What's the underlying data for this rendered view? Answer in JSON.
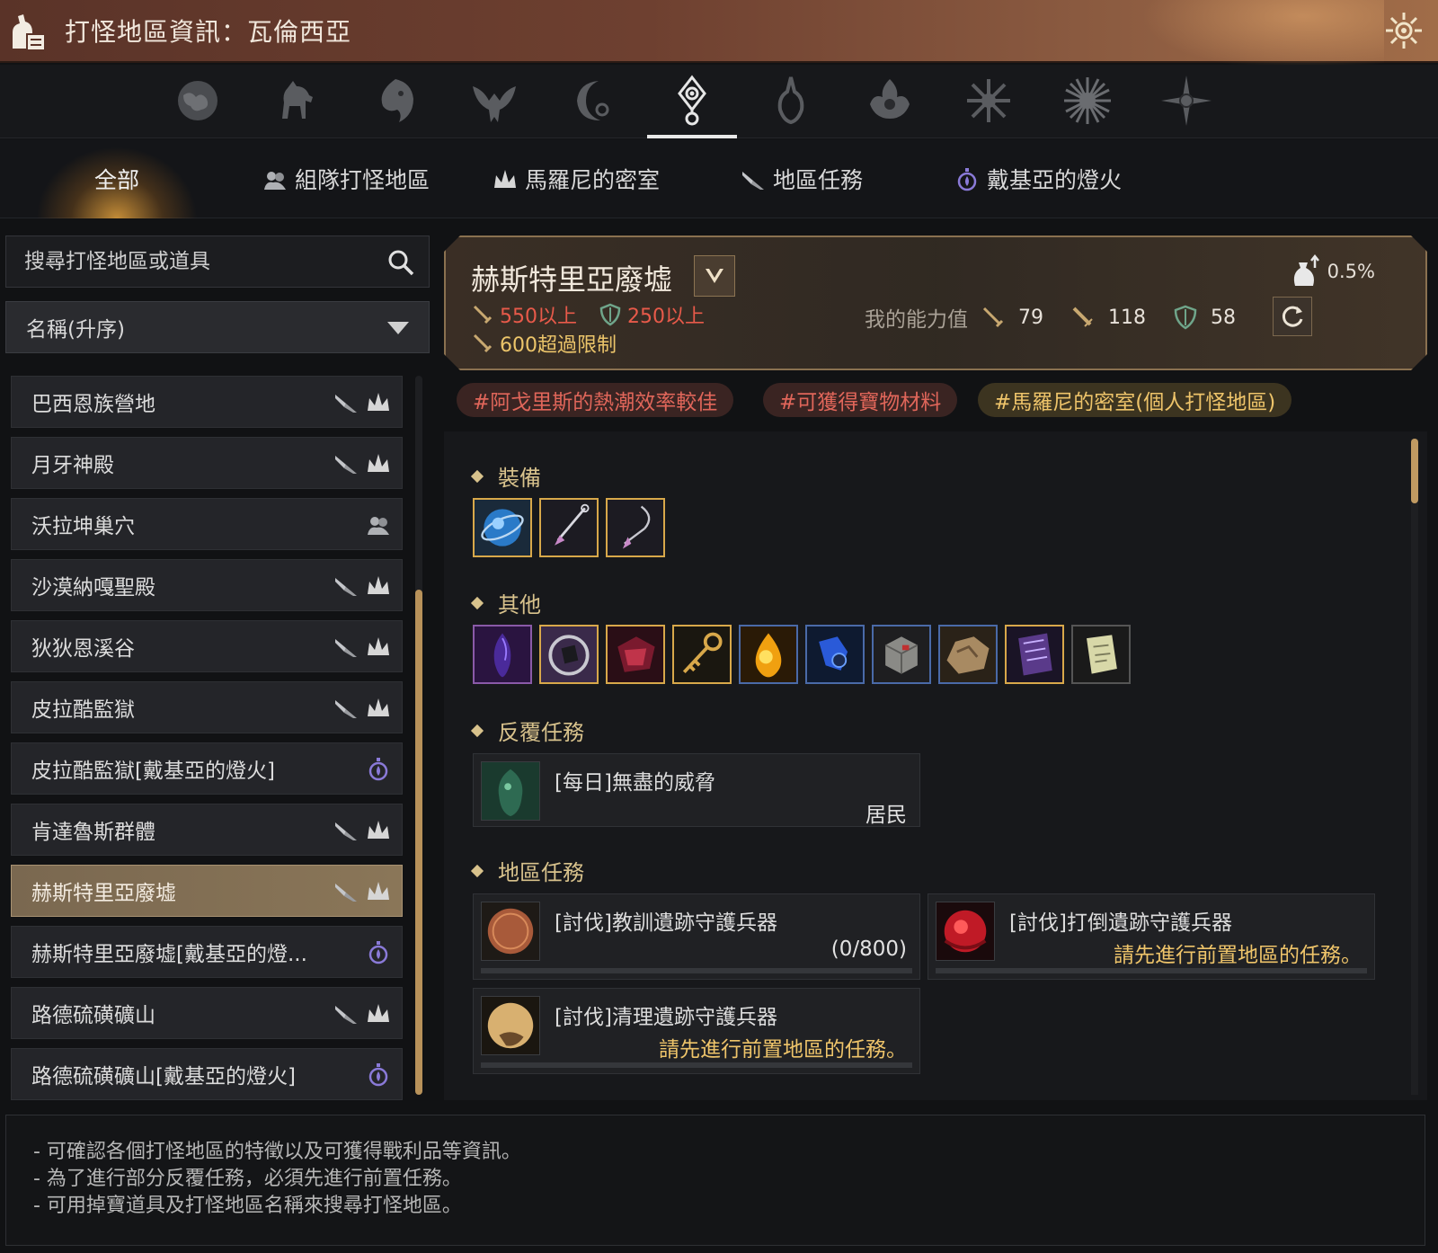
{
  "window": {
    "title": "打怪地區資訊：瓦倫西亞",
    "title_icon": "scroll-bag-icon",
    "settings_icon": "gear-icon"
  },
  "region_icons": [
    {
      "name": "world-icon",
      "active": false
    },
    {
      "name": "horse-icon",
      "active": false
    },
    {
      "name": "lion-icon",
      "active": false
    },
    {
      "name": "eagle-crest-icon",
      "active": false
    },
    {
      "name": "crescent-moon-icon",
      "active": false
    },
    {
      "name": "eye-crest-icon",
      "active": true
    },
    {
      "name": "flame-crest-icon",
      "active": false
    },
    {
      "name": "lotus-crest-icon",
      "active": false
    },
    {
      "name": "star-crest-icon",
      "active": false
    },
    {
      "name": "sun-burst-icon",
      "active": false
    },
    {
      "name": "compass-star-icon",
      "active": false
    }
  ],
  "tabs": [
    {
      "label": "全部",
      "active": true
    },
    {
      "label": "組隊打怪地區",
      "icon": "party-icon"
    },
    {
      "label": "馬羅尼的密室",
      "icon": "marni-crown-icon"
    },
    {
      "label": "地區任務",
      "icon": "quest-icon"
    },
    {
      "label": "戴基亞的燈火",
      "icon": "lantern-icon"
    }
  ],
  "sidebar": {
    "search_placeholder": "搜尋打怪地區或道具",
    "sort_label": "名稱(升序)",
    "items": [
      {
        "label": "巴西恩族營地",
        "tags": [
          "quest-icon",
          "marni-crown-icon"
        ]
      },
      {
        "label": "月牙神殿",
        "tags": [
          "quest-icon",
          "marni-crown-icon"
        ]
      },
      {
        "label": "沃拉坤巢穴",
        "tags": [
          "party-icon"
        ]
      },
      {
        "label": "沙漠納嘎聖殿",
        "tags": [
          "quest-icon",
          "marni-crown-icon"
        ]
      },
      {
        "label": "狄狄恩溪谷",
        "tags": [
          "quest-icon",
          "marni-crown-icon"
        ]
      },
      {
        "label": "皮拉酷監獄",
        "tags": [
          "quest-icon",
          "marni-crown-icon"
        ]
      },
      {
        "label": "皮拉酷監獄[戴基亞的燈火]",
        "tags": [
          "lantern-icon"
        ]
      },
      {
        "label": "肯達魯斯群體",
        "tags": [
          "quest-icon",
          "marni-crown-icon"
        ]
      },
      {
        "label": "赫斯特里亞廢墟",
        "tags": [
          "quest-icon",
          "marni-crown-icon"
        ],
        "selected": true
      },
      {
        "label": "赫斯特里亞廢墟[戴基亞的燈...",
        "tags": [
          "lantern-icon"
        ]
      },
      {
        "label": "路德硫磺礦山",
        "tags": [
          "quest-icon",
          "marni-crown-icon"
        ]
      },
      {
        "label": "路德硫磺礦山[戴基亞的燈火]",
        "tags": [
          "lantern-icon"
        ]
      }
    ]
  },
  "detail": {
    "area_name": "赫斯特里亞廢墟",
    "req_ap": "550以上",
    "req_dp": "250以上",
    "req_cap": "600超過限制",
    "my_stats_label": "我的能力值",
    "my_ap": "79",
    "my_aap": "118",
    "my_dp": "58",
    "drop_rate": "0.5%",
    "colors": {
      "warning_red": "#e85a4a",
      "notice_yellow": "#ecc56a"
    }
  },
  "hashtags": [
    "#阿戈里斯的熱潮效率較佳",
    "#可獲得寶物材料",
    "#馬羅尼的密室(個人打怪地區)"
  ],
  "sections": {
    "equipment": "裝備",
    "other": "其他",
    "repeat_quests": "反覆任務",
    "area_quests": "地區任務"
  },
  "equipment_items": [
    "blue-orb-icon",
    "spear-earring-icon",
    "pendant-necklace-icon"
  ],
  "other_items": [
    "purple-crystal-icon",
    "dark-ring-icon",
    "red-gem-box-icon",
    "golden-key-icon",
    "amber-drop-icon",
    "blue-tool-icon",
    "stone-cube-icon",
    "ore-chunk-icon",
    "purple-scroll-icon",
    "paper-note-icon"
  ],
  "repeat_quest": {
    "title": "[每日]無盡的威脅",
    "sub": "居民"
  },
  "area_quests": [
    {
      "title": "[討伐]教訓遺跡守護兵器",
      "sub": "(0/800)",
      "type": "progress"
    },
    {
      "title": "[討伐]打倒遺跡守護兵器",
      "sub": "請先進行前置地區的任務。",
      "type": "locked"
    },
    {
      "title": "[討伐]清理遺跡守護兵器",
      "sub": "請先進行前置地區的任務。",
      "type": "locked"
    }
  ],
  "notes": [
    "- 可確認各個打怪地區的特徵以及可獲得戰利品等資訊。",
    "- 為了進行部分反覆任務，必須先進行前置任務。",
    "- 可用掉寶道具及打怪地區名稱來搜尋打怪地區。"
  ]
}
